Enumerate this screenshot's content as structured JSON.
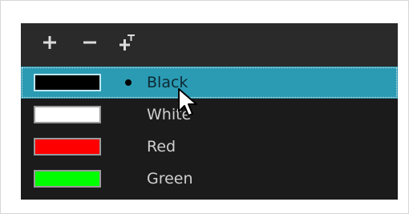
{
  "toolbar": {
    "buttons": [
      {
        "name": "add-color-button",
        "icon": "plus-icon"
      },
      {
        "name": "remove-color-button",
        "icon": "minus-icon"
      },
      {
        "name": "add-texture-button",
        "icon": "add-texture-icon"
      }
    ]
  },
  "swatches": [
    {
      "label": "Black",
      "color": "#000000",
      "selected": true,
      "current": true
    },
    {
      "label": "White",
      "color": "#ffffff",
      "selected": false,
      "current": false
    },
    {
      "label": "Red",
      "color": "#ff0000",
      "selected": false,
      "current": false
    },
    {
      "label": "Green",
      "color": "#00ff00",
      "selected": false,
      "current": false
    }
  ],
  "colors": {
    "panel_bg": "#1b1b1b",
    "toolbar_bg": "#2a2a2a",
    "selection": "#2b9bb4"
  },
  "icons": {
    "cursor": "arrow-cursor-icon"
  }
}
